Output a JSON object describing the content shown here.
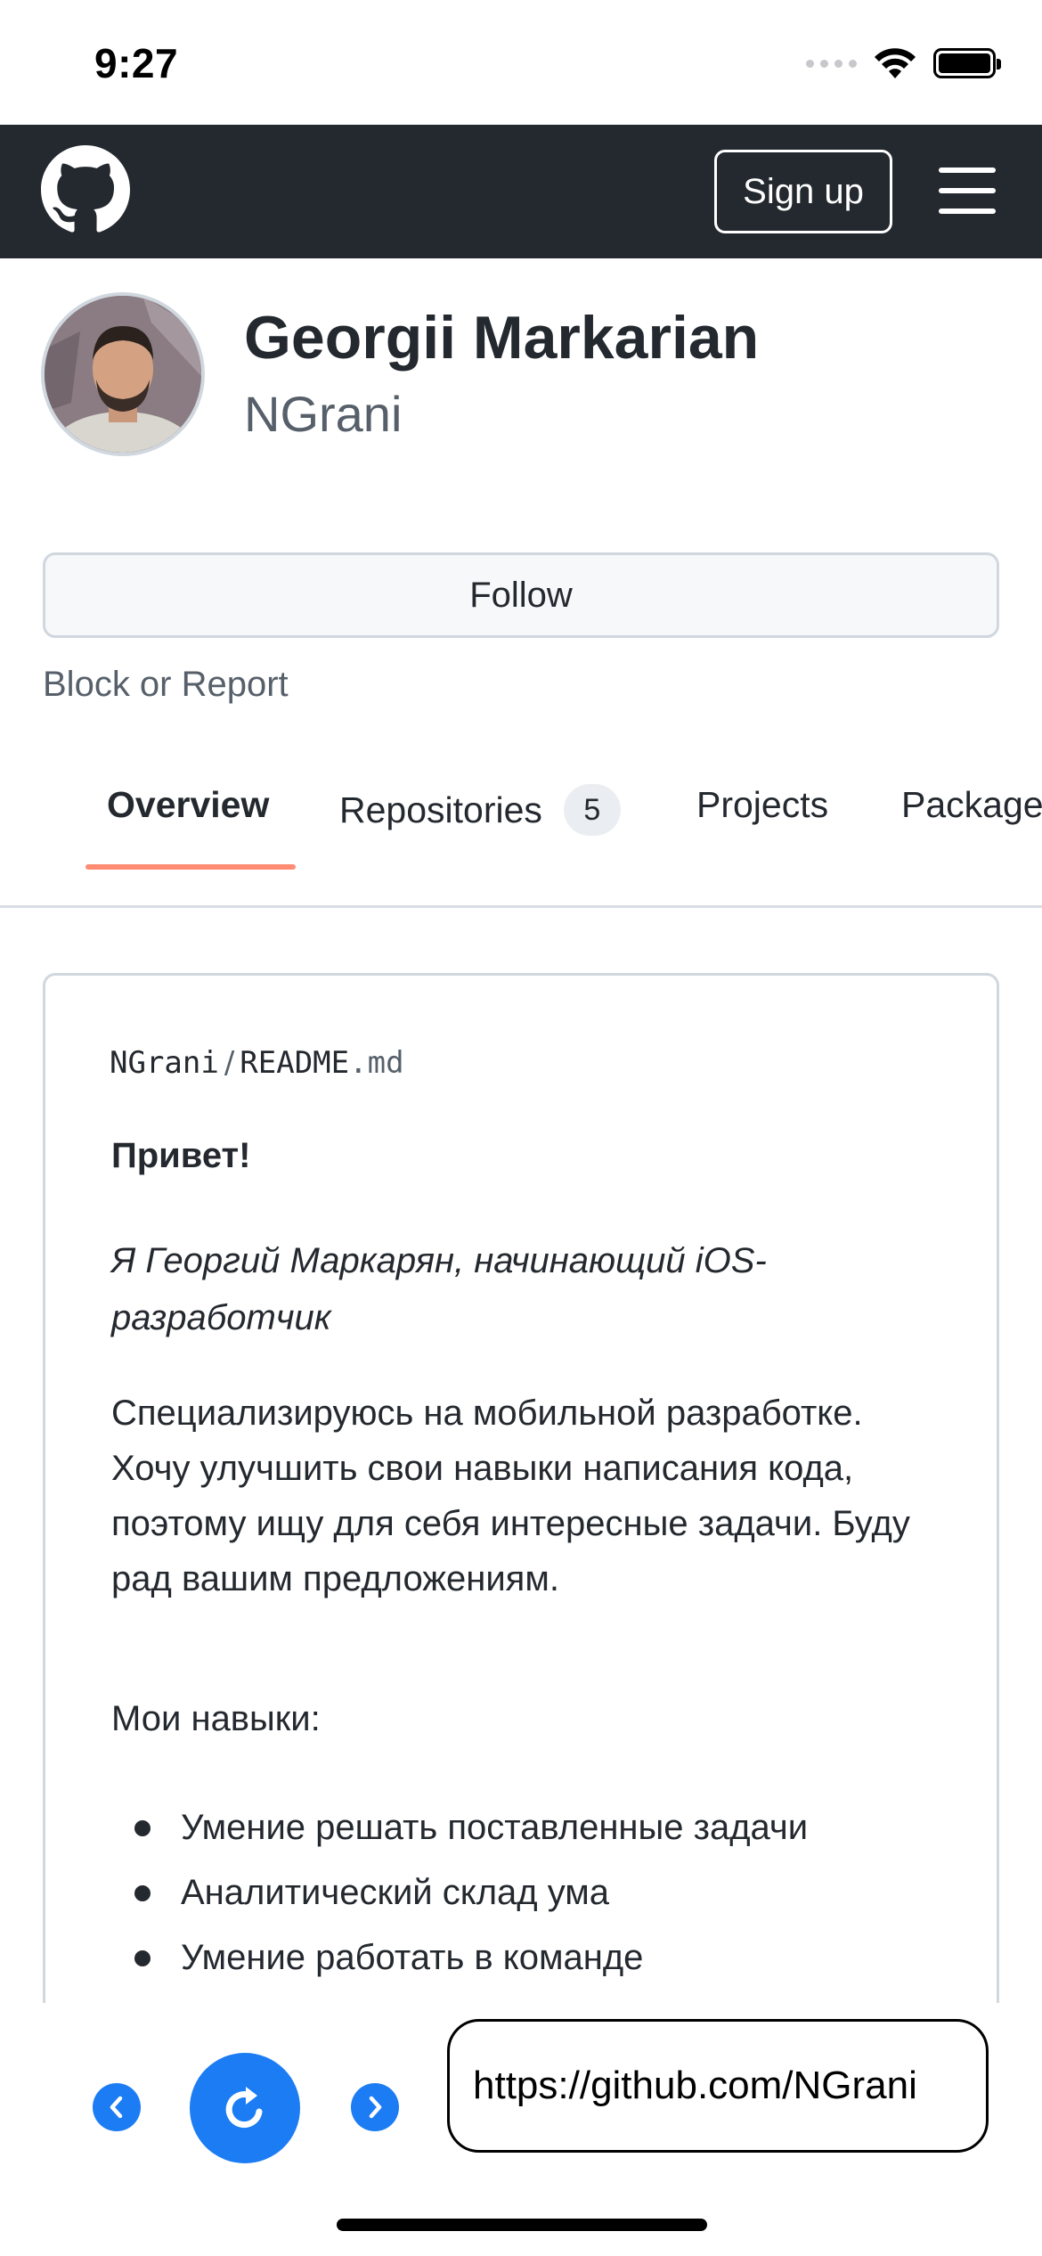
{
  "status_bar": {
    "time": "9:27"
  },
  "header": {
    "signup_label": "Sign up"
  },
  "profile": {
    "name": "Georgii Markarian",
    "login": "NGrani"
  },
  "actions": {
    "follow_label": "Follow",
    "block_report_label": "Block or Report"
  },
  "tabs": [
    {
      "label": "Overview",
      "active": true
    },
    {
      "label": "Repositories",
      "count": "5"
    },
    {
      "label": "Projects"
    },
    {
      "label": "Packages"
    }
  ],
  "readme": {
    "owner": "NGrani",
    "separator": "/",
    "file_base": "README",
    "file_ext": ".md",
    "greeting": "Привет!",
    "intro": "Я Георгий Маркарян, начинающий iOS-разработчик",
    "paragraph": "Специализируюсь на мобильной разработке. Хочу улучшить свои навыки написания кода, поэтому ищу для себя интересные задачи. Буду рад вашим предложениям.",
    "skills_heading": "Мои навыки:",
    "skills": [
      "Умение решать поставленные задачи",
      "Аналитический склад ума",
      "Умение работать в команде"
    ]
  },
  "browser": {
    "url": "https://github.com/NGrani"
  },
  "colors": {
    "header_bg": "#24292f",
    "accent_blue": "#1c7cf4",
    "tab_underline": "#fd8c73"
  }
}
